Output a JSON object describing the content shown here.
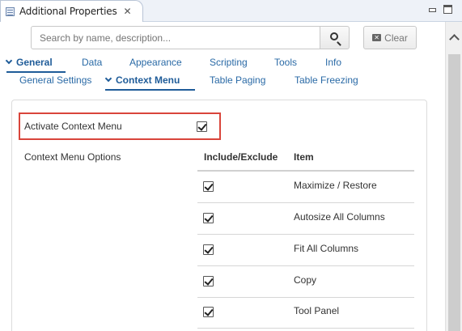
{
  "view": {
    "title": "Additional Properties",
    "close_glyph": "✕"
  },
  "search": {
    "placeholder": "Search by name, description...",
    "clear_label": "Clear"
  },
  "category_tabs": [
    {
      "label": "General",
      "active": true
    },
    {
      "label": "Data",
      "active": false
    },
    {
      "label": "Appearance",
      "active": false
    },
    {
      "label": "Scripting",
      "active": false
    },
    {
      "label": "Tools",
      "active": false
    },
    {
      "label": "Info",
      "active": false
    }
  ],
  "sub_tabs": [
    {
      "label": "General Settings",
      "active": false
    },
    {
      "label": "Context Menu",
      "active": true
    },
    {
      "label": "Table Paging",
      "active": false
    },
    {
      "label": "Table Freezing",
      "active": false
    }
  ],
  "context_menu": {
    "activate_label": "Activate Context Menu",
    "activate_checked": true,
    "options_label": "Context Menu Options",
    "table": {
      "headers": [
        "Include/Exclude",
        "Item"
      ],
      "rows": [
        {
          "checked": true,
          "item": "Maximize / Restore"
        },
        {
          "checked": true,
          "item": "Autosize All Columns"
        },
        {
          "checked": true,
          "item": "Fit All Columns"
        },
        {
          "checked": true,
          "item": "Copy"
        },
        {
          "checked": true,
          "item": "Tool Panel"
        }
      ]
    }
  },
  "colors": {
    "link": "#2a6aa6",
    "active_link": "#1f5c99",
    "highlight_border": "#d9453b"
  }
}
